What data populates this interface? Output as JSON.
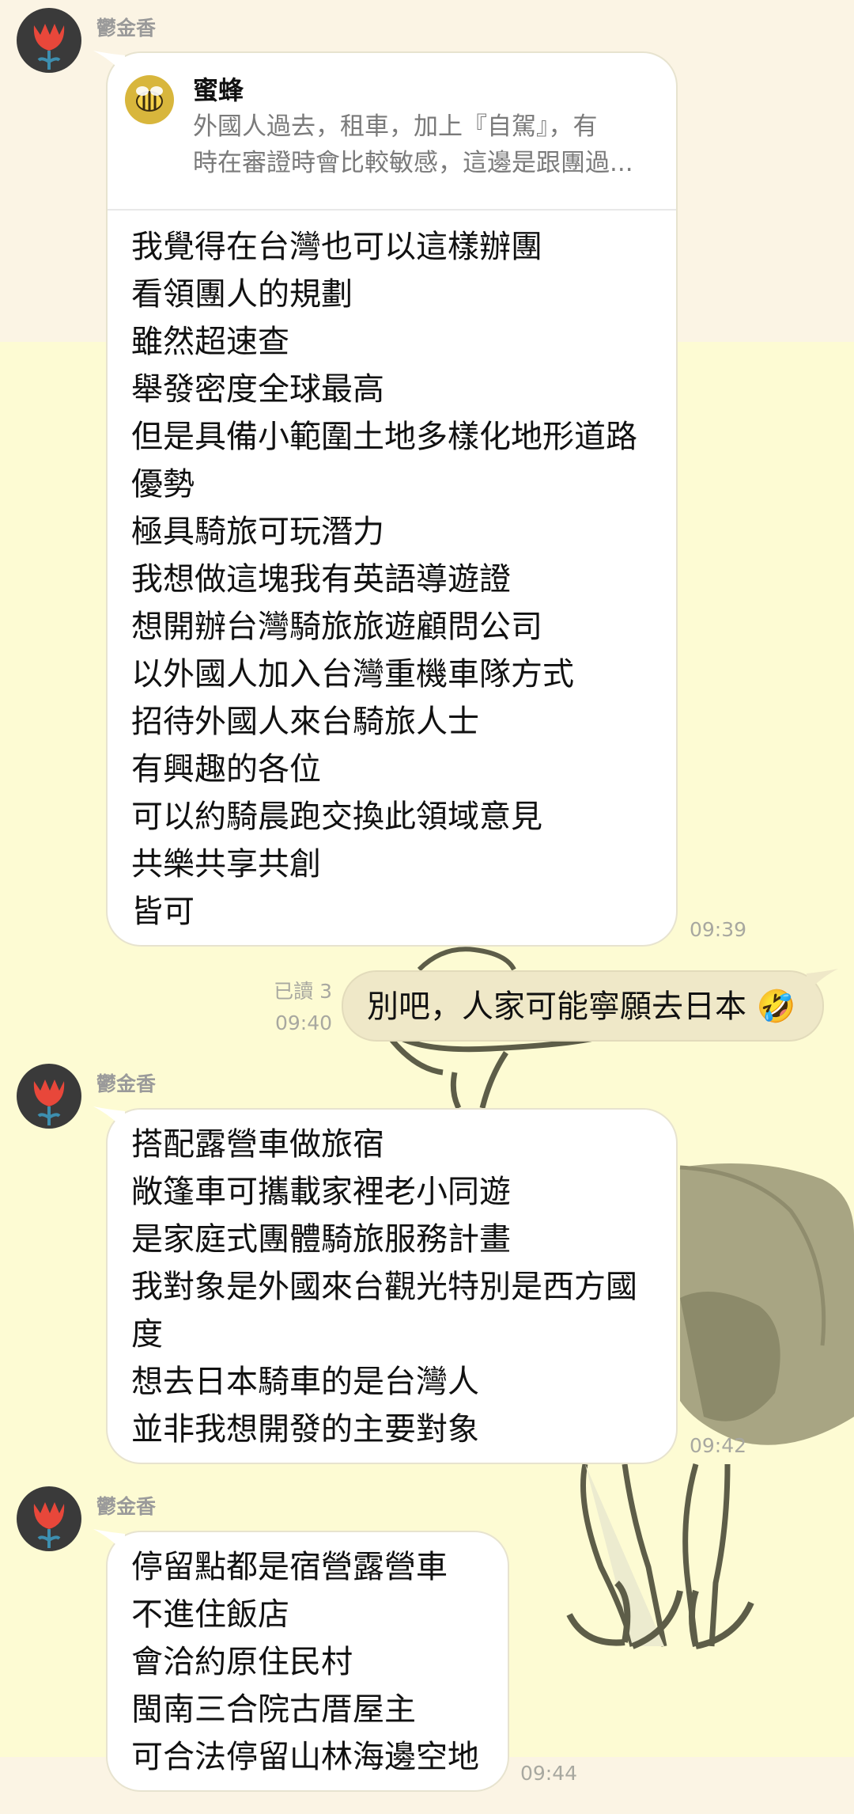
{
  "chat": {
    "messages": [
      {
        "sender": "鬱金香",
        "quote": {
          "name": "蜜蜂",
          "line1": "外國人過去，租車，加上『自駕』，有",
          "line2": "時在審證時會比較敏感，這邊是跟團過..."
        },
        "lines": [
          "我覺得在台灣也可以這樣辦團",
          "看領團人的規劃",
          "雖然超速查",
          "舉發密度全球最高",
          "但是具備小範圍土地多樣化地形道路",
          "優勢",
          "極具騎旅可玩潛力",
          "我想做這塊我有英語導遊證",
          "想開辦台灣騎旅旅遊顧問公司",
          "以外國人加入台灣重機車隊方式",
          "招待外國人來台騎旅人士",
          "有興趣的各位",
          "可以約騎晨跑交換此領域意見",
          "共樂共享共創",
          "皆可"
        ],
        "time": "09:39"
      },
      {
        "mine": true,
        "text": "別吧，人家可能寧願去日本",
        "emoji": "🤣",
        "read": "已讀 3",
        "time": "09:40"
      },
      {
        "sender": "鬱金香",
        "lines": [
          "搭配露營車做旅宿",
          "敞篷車可攜載家裡老小同遊",
          "是家庭式團體騎旅服務計畫",
          "我對象是外國來台觀光特別是西方國",
          "度",
          "想去日本騎車的是台灣人",
          "並非我想開發的主要對象"
        ],
        "time": "09:42"
      },
      {
        "sender": "鬱金香",
        "lines": [
          "停留點都是宿營露營車",
          "不進住飯店",
          "會洽約原住民村",
          "閩南三合院古厝屋主",
          "可合法停留山林海邊空地"
        ],
        "time": "09:44"
      }
    ]
  }
}
